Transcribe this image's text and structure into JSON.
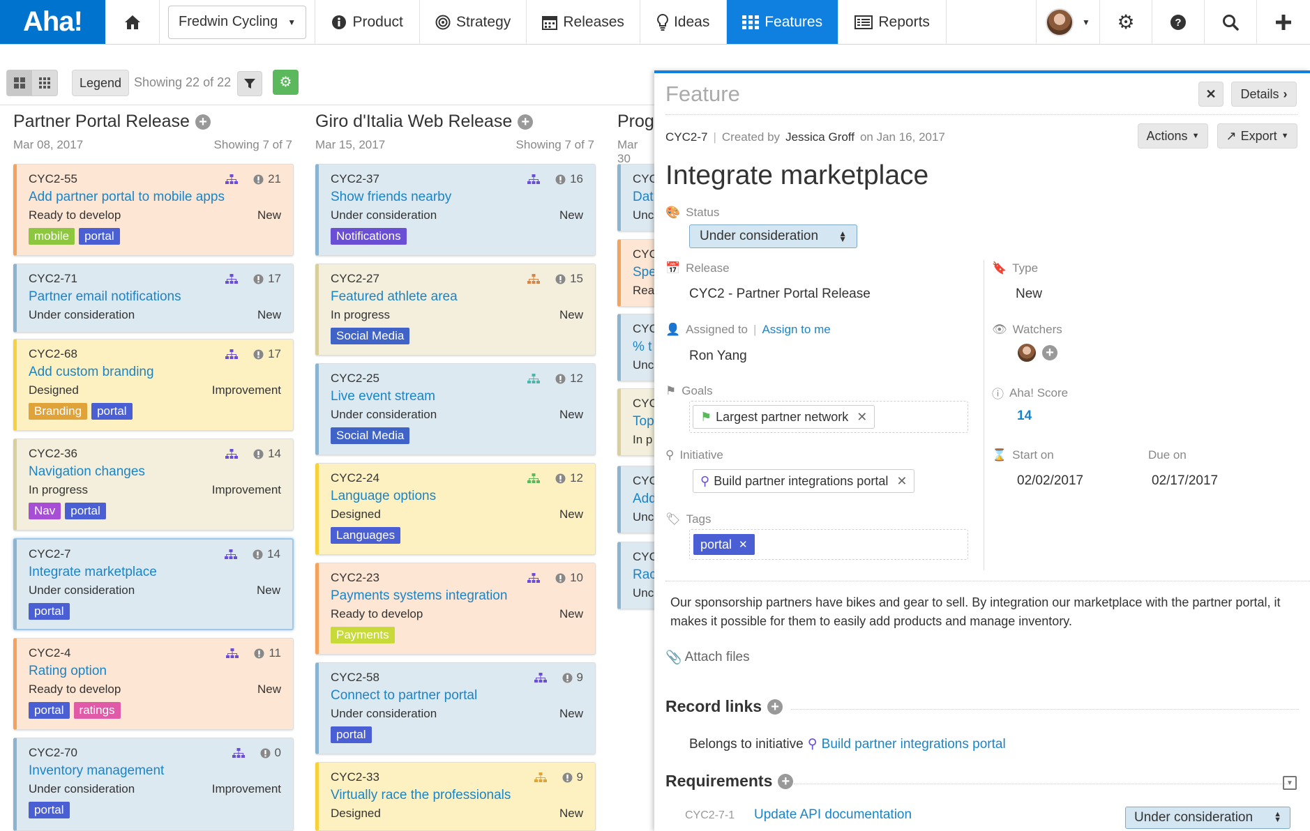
{
  "nav": {
    "logo": "Aha!",
    "product": "Fredwin Cycling",
    "items": [
      {
        "label": "Product",
        "icon": "info-icon"
      },
      {
        "label": "Strategy",
        "icon": "target-icon"
      },
      {
        "label": "Releases",
        "icon": "calendar-icon"
      },
      {
        "label": "Ideas",
        "icon": "lightbulb-icon"
      },
      {
        "label": "Features",
        "icon": "grid-icon"
      },
      {
        "label": "Reports",
        "icon": "report-icon"
      }
    ],
    "active": "Features"
  },
  "toolbar": {
    "legend": "Legend",
    "showing": "Showing 22 of 22"
  },
  "columns": [
    {
      "title": "Partner Portal Release",
      "date": "Mar 08, 2017",
      "showing": "Showing 7 of 7"
    },
    {
      "title": "Giro d'Italia Web Release",
      "date": "Mar 15, 2017",
      "showing": "Showing 7 of 7"
    },
    {
      "title": "Prog",
      "date": "Mar 30"
    }
  ],
  "cards_col1": [
    {
      "id": "CYC2-55",
      "name": "Add partner portal to mobile apps",
      "status": "Ready to develop",
      "type": "New",
      "score": "21",
      "bg": "#fde6d4",
      "border": "#f5a35c",
      "tags": [
        {
          "t": "mobile",
          "c": "#8dc63f"
        },
        {
          "t": "portal",
          "c": "#4a5fd4"
        }
      ]
    },
    {
      "id": "CYC2-71",
      "name": "Partner email notifications",
      "status": "Under consideration",
      "type": "New",
      "score": "17",
      "bg": "#dde9f1",
      "border": "#8ab4cf",
      "tags": []
    },
    {
      "id": "CYC2-68",
      "name": "Add custom branding",
      "status": "Designed",
      "type": "Improvement",
      "score": "17",
      "bg": "#fdf1c2",
      "border": "#f7d13b",
      "tags": [
        {
          "t": "Branding",
          "c": "#e0a33a"
        },
        {
          "t": "portal",
          "c": "#4a5fd4"
        }
      ]
    },
    {
      "id": "CYC2-36",
      "name": "Navigation changes",
      "status": "In progress",
      "type": "Improvement",
      "score": "14",
      "bg": "#f3efdc",
      "border": "#d9cf9a",
      "tags": [
        {
          "t": "Nav",
          "c": "#a64fd4"
        },
        {
          "t": "portal",
          "c": "#4a5fd4"
        }
      ]
    },
    {
      "id": "CYC2-7",
      "name": "Integrate marketplace",
      "status": "Under consideration",
      "type": "New",
      "score": "14",
      "bg": "#dde9f1",
      "border": "#8ab4cf",
      "tags": [
        {
          "t": "portal",
          "c": "#4a5fd4"
        }
      ]
    },
    {
      "id": "CYC2-4",
      "name": "Rating option",
      "status": "Ready to develop",
      "type": "New",
      "score": "11",
      "bg": "#fde6d4",
      "border": "#f5a35c",
      "tags": [
        {
          "t": "portal",
          "c": "#4a5fd4"
        },
        {
          "t": "ratings",
          "c": "#e05aa8"
        }
      ]
    },
    {
      "id": "CYC2-70",
      "name": "Inventory management",
      "status": "Under consideration",
      "type": "Improvement",
      "score": "0",
      "bg": "#dde9f1",
      "border": "#8ab4cf",
      "tags": [
        {
          "t": "portal",
          "c": "#4a5fd4"
        }
      ]
    }
  ],
  "cards_col2": [
    {
      "id": "CYC2-37",
      "name": "Show friends nearby",
      "status": "Under consideration",
      "type": "New",
      "score": "16",
      "bg": "#dde9f1",
      "border": "#8ab4cf",
      "tags": [
        {
          "t": "Notifications",
          "c": "#6a4fd4"
        }
      ]
    },
    {
      "id": "CYC2-27",
      "name": "Featured athlete area",
      "status": "In progress",
      "type": "New",
      "score": "15",
      "bg": "#f3efdc",
      "border": "#d9cf9a",
      "tags": [
        {
          "t": "Social Media",
          "c": "#3f63c6"
        }
      ]
    },
    {
      "id": "CYC2-25",
      "name": "Live event stream",
      "status": "Under consideration",
      "type": "New",
      "score": "12",
      "bg": "#dde9f1",
      "border": "#8ab4cf",
      "tags": [
        {
          "t": "Social Media",
          "c": "#3f63c6"
        }
      ]
    },
    {
      "id": "CYC2-24",
      "name": "Language options",
      "status": "Designed",
      "type": "New",
      "score": "12",
      "bg": "#fdf1c2",
      "border": "#f7d13b",
      "tags": [
        {
          "t": "Languages",
          "c": "#4a5fd4"
        }
      ]
    },
    {
      "id": "CYC2-23",
      "name": "Payments systems integration",
      "status": "Ready to develop",
      "type": "New",
      "score": "10",
      "bg": "#fde6d4",
      "border": "#f5a35c",
      "tags": [
        {
          "t": "Payments",
          "c": "#c8d93a"
        }
      ]
    },
    {
      "id": "CYC2-58",
      "name": "Connect to partner portal",
      "status": "Under consideration",
      "type": "New",
      "score": "9",
      "bg": "#dde9f1",
      "border": "#8ab4cf",
      "tags": [
        {
          "t": "portal",
          "c": "#4a5fd4"
        }
      ]
    },
    {
      "id": "CYC2-33",
      "name": "Virtually race the professionals",
      "status": "Designed",
      "type": "New",
      "score": "9",
      "bg": "#fdf1c2",
      "border": "#f7d13b",
      "tags": []
    }
  ],
  "cards_col3": [
    {
      "id": "CYC",
      "name": "Dat",
      "status": "Unc",
      "bg": "#dde9f1",
      "border": "#8ab4cf"
    },
    {
      "id": "CYC",
      "name": "Spe",
      "status": "Rea",
      "bg": "#fde6d4",
      "border": "#f5a35c"
    },
    {
      "id": "CYC",
      "name": "% t",
      "status": "Unc",
      "bg": "#dde9f1",
      "border": "#8ab4cf"
    },
    {
      "id": "CYC",
      "name": "Top",
      "status": "In p",
      "bg": "#f3efdc",
      "border": "#d9cf9a"
    },
    {
      "id": "CYC",
      "name": "Add",
      "status": "Unc",
      "bg": "#dde9f1",
      "border": "#8ab4cf"
    },
    {
      "id": "CYC",
      "name": "Rac",
      "status": "Unc",
      "bg": "#dde9f1",
      "border": "#8ab4cf"
    }
  ],
  "panel": {
    "header": "Feature",
    "details_label": "Details",
    "ref": "CYC2-7",
    "created_by_label": "Created by",
    "author": "Jessica Groff",
    "on_label": "on Jan 16, 2017",
    "actions_label": "Actions",
    "export_label": "Export",
    "title": "Integrate marketplace",
    "status_label": "Status",
    "status_value": "Under consideration",
    "release_label": "Release",
    "release_value": "CYC2 - Partner Portal Release",
    "assigned_label": "Assigned to",
    "assign_me": "Assign to me",
    "assignee": "Ron Yang",
    "goals_label": "Goals",
    "goal": "Largest partner network",
    "initiative_label": "Initiative",
    "initiative": "Build partner integrations portal",
    "tags_label": "Tags",
    "tag": "portal",
    "type_label": "Type",
    "type_value": "New",
    "watchers_label": "Watchers",
    "score_label": "Aha! Score",
    "score_value": "14",
    "start_label": "Start on",
    "start_value": "02/02/2017",
    "due_label": "Due on",
    "due_value": "02/17/2017",
    "description": "Our sponsorship partners have bikes and gear to sell. By integration our marketplace with the partner portal, it makes it possible for them to easily add products and manage inventory.",
    "attach": "Attach files",
    "record_links": "Record links",
    "belongs_label": "Belongs to initiative",
    "belongs_value": "Build partner integrations portal",
    "requirements": "Requirements",
    "req_id": "CYC2-7-1",
    "req_name": "Update API documentation",
    "req_status": "Under consideration"
  }
}
